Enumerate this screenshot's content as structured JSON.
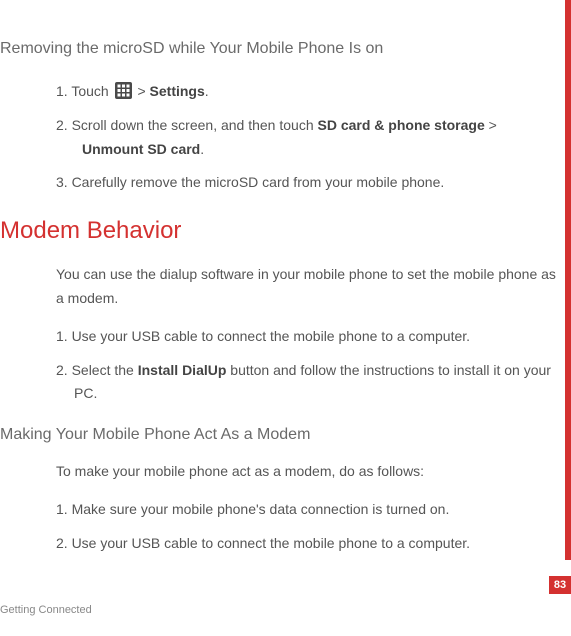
{
  "headings": {
    "h1": "Removing the microSD while Your Mobile Phone Is on",
    "h2": "Modem Behavior",
    "h3": "Making Your Mobile Phone Act As a Modem"
  },
  "section1": {
    "step1_a": "1. Touch ",
    "step1_b": " > ",
    "step1_c": "Settings",
    "step1_d": ".",
    "step2_a": "2. Scroll down the screen, and then touch ",
    "step2_b": "SD card & phone storage",
    "step2_c": " > ",
    "step2_d": "Unmount SD card",
    "step2_e": ".",
    "step3": "3. Carefully remove the microSD card from your mobile phone."
  },
  "section2": {
    "intro": "You can use the dialup software in your mobile phone to set the mobile phone as a modem.",
    "step1": "1. Use your USB cable to connect the mobile phone to a computer.",
    "step2_a": "2. Select the ",
    "step2_b": "Install DialUp",
    "step2_c": " button and follow the instructions to install it on your PC."
  },
  "section3": {
    "intro": "To make your mobile phone act as a modem, do as follows:",
    "step1": "1. Make sure your mobile phone's data connection is turned on.",
    "step2": "2. Use your USB cable to connect the mobile phone to a computer."
  },
  "footer": "Getting Connected",
  "page_number": "83"
}
